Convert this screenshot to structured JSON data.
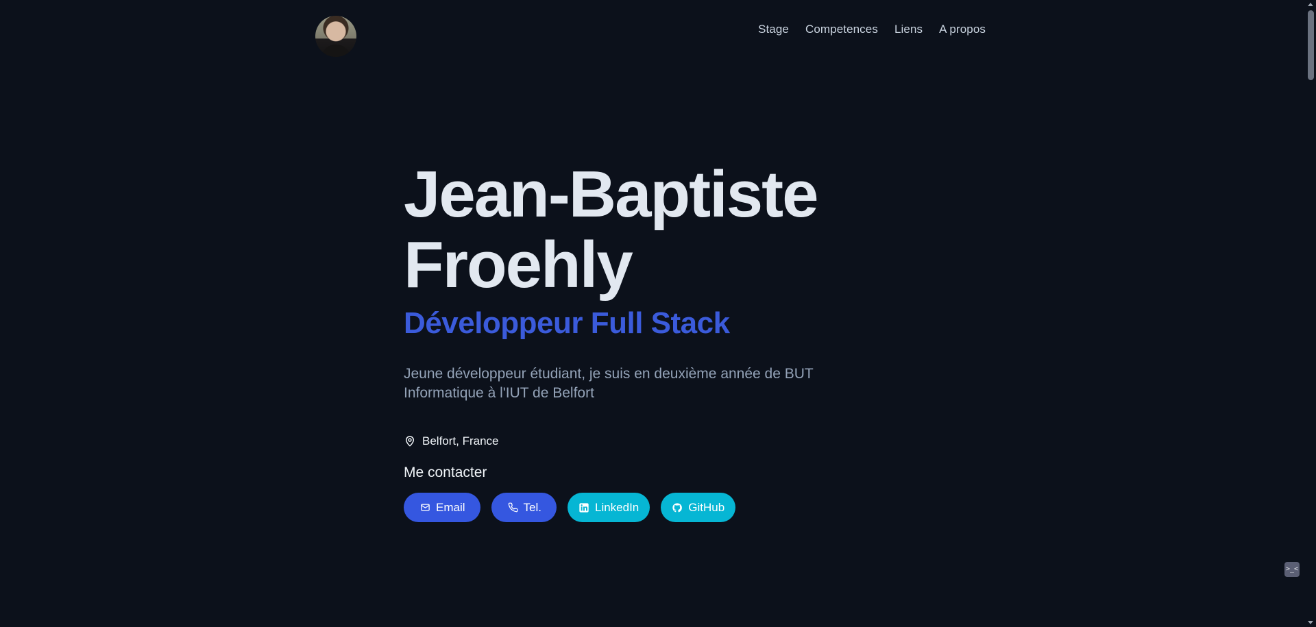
{
  "header": {
    "nav": [
      {
        "label": "Stage"
      },
      {
        "label": "Competences"
      },
      {
        "label": "Liens"
      },
      {
        "label": "A propos"
      }
    ]
  },
  "hero": {
    "name_line1": "Jean-Baptiste",
    "name_line2": "Froehly",
    "role": "Développeur Full Stack",
    "bio_line1": "Jeune développeur étudiant, je suis en deuxième année de BUT",
    "bio_line2": "Informatique à l'IUT de Belfort",
    "location": "Belfort, France",
    "contact_title": "Me contacter",
    "buttons": [
      {
        "label": "Email",
        "icon": "mail-icon"
      },
      {
        "label": "Tel.",
        "icon": "phone-icon"
      },
      {
        "label": "LinkedIn",
        "icon": "linkedin-icon"
      },
      {
        "label": "GitHub",
        "icon": "github-icon"
      }
    ]
  },
  "widget": {
    "label": ">_<"
  },
  "colors": {
    "background": "#0c111b",
    "accent_blue": "#3557e0",
    "accent_cyan": "#06b6d4",
    "role_text": "#3b5bdb"
  }
}
